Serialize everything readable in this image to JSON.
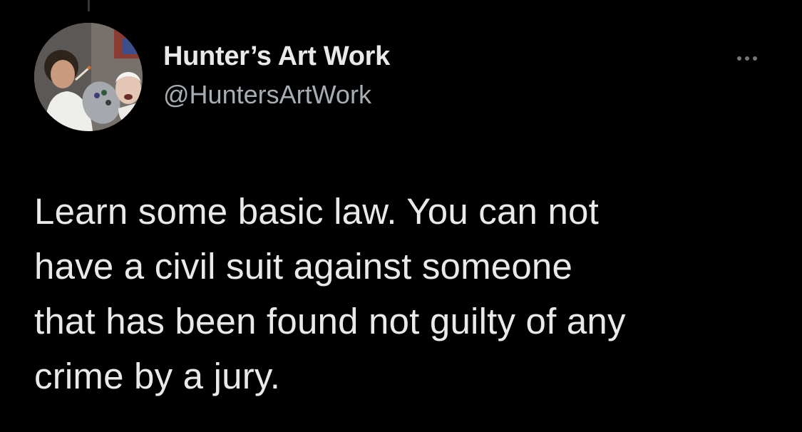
{
  "tweet": {
    "author": {
      "display_name": "Hunter’s Art Work",
      "handle": "@HuntersArtWork",
      "avatar": "profile-photo"
    },
    "text": "Learn some basic law. You can not\nhave a civil suit against someone\nthat has been found not guilty of any\ncrime by a jury."
  },
  "icons": {
    "more": "more-horizontal-icon"
  },
  "colors": {
    "background": "#000000",
    "primary_text": "#e7e9ea",
    "secondary_text": "#a7adb3",
    "icon": "#71767b"
  }
}
